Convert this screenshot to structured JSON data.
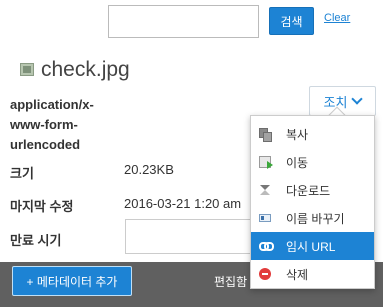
{
  "search": {
    "value": "",
    "button_label": "검색",
    "clear_label": "Clear"
  },
  "file": {
    "name": "check.jpg",
    "mime_type": "application/x-www-form-urlencoded"
  },
  "actions": {
    "button_label": "조치",
    "menu": [
      {
        "label": "복사",
        "icon": "copy-icon"
      },
      {
        "label": "이동",
        "icon": "move-icon"
      },
      {
        "label": "다운로드",
        "icon": "download-icon"
      },
      {
        "label": "이름 바꾸기",
        "icon": "rename-icon"
      },
      {
        "label": "임시 URL",
        "icon": "link-icon",
        "selected": true
      },
      {
        "label": "삭제",
        "icon": "delete-icon"
      }
    ]
  },
  "metadata": {
    "size_label": "크기",
    "size_value": "20.23KB",
    "modified_label": "마지막 수정",
    "modified_value": "2016-03-21 1:20 am",
    "expiry_label": "만료 시기",
    "expiry_value": ""
  },
  "footer": {
    "add_metadata_label": "+ 메타데이터 추가",
    "edit_label": "편집함"
  },
  "colors": {
    "accent": "#1d83d4",
    "bottom_bar": "#606060",
    "delete": "#e23b3b"
  }
}
